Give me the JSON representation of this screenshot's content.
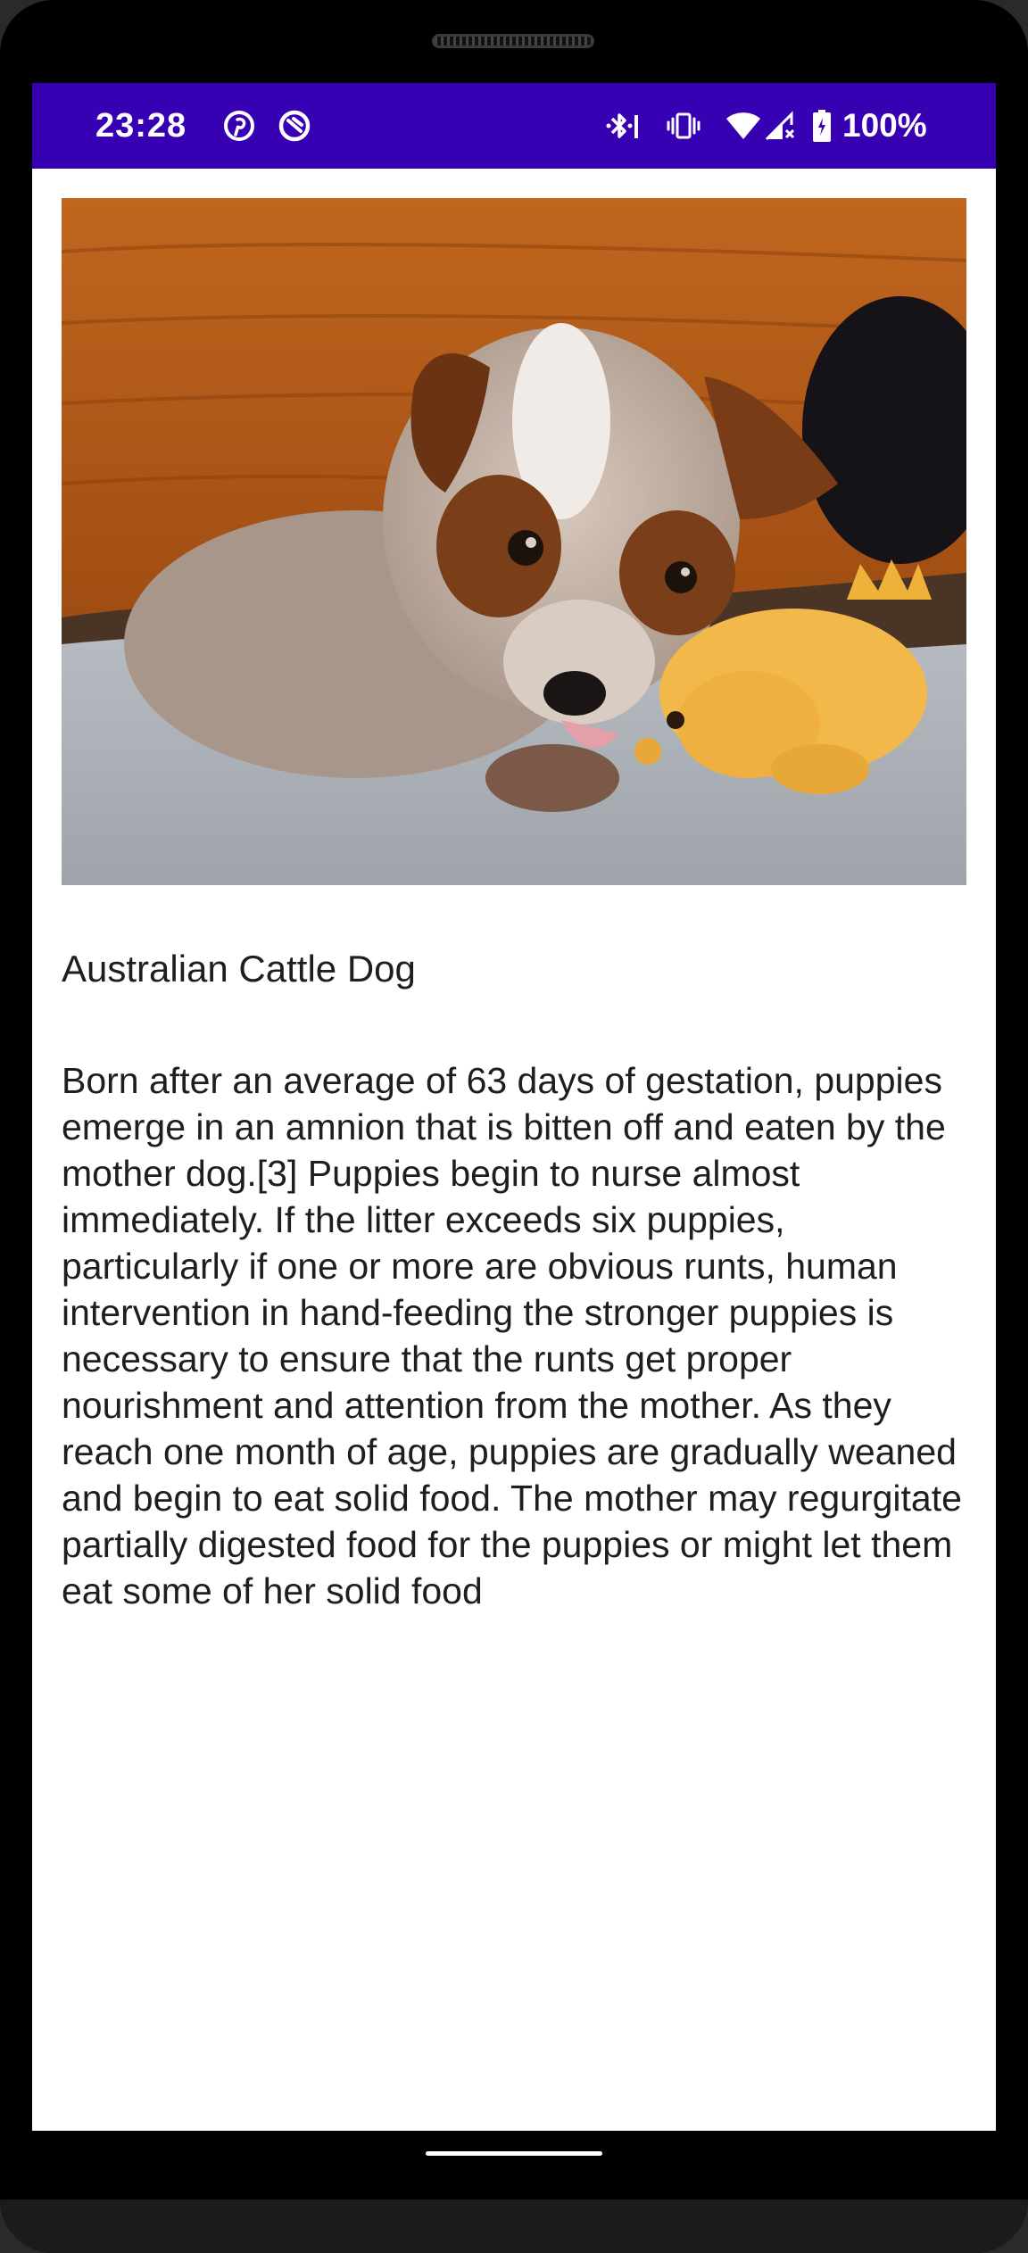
{
  "status_bar": {
    "time": "23:28",
    "battery": "100%",
    "icons": [
      "pinterest-icon",
      "app-notification-icon",
      "bluetooth-icon",
      "vibrate-icon",
      "wifi-icon",
      "cell-signal-icon",
      "battery-icon"
    ],
    "background_color": "#3700b3"
  },
  "content": {
    "title": "Australian Cattle Dog",
    "description": "Born after an average of 63 days of gestation, puppies emerge in an amnion that is bitten off and eaten by the mother dog.[3] Puppies begin to nurse almost immediately. If the litter exceeds six puppies, particularly if one or more are obvious runts, human intervention in hand-feeding the stronger puppies is necessary to ensure that the runts get proper nourishment and attention from the mother. As they reach one month of age, puppies are gradually weaned and begin to eat solid food. The mother may regurgitate partially digested food for the puppies or might let them eat some of her solid food"
  }
}
